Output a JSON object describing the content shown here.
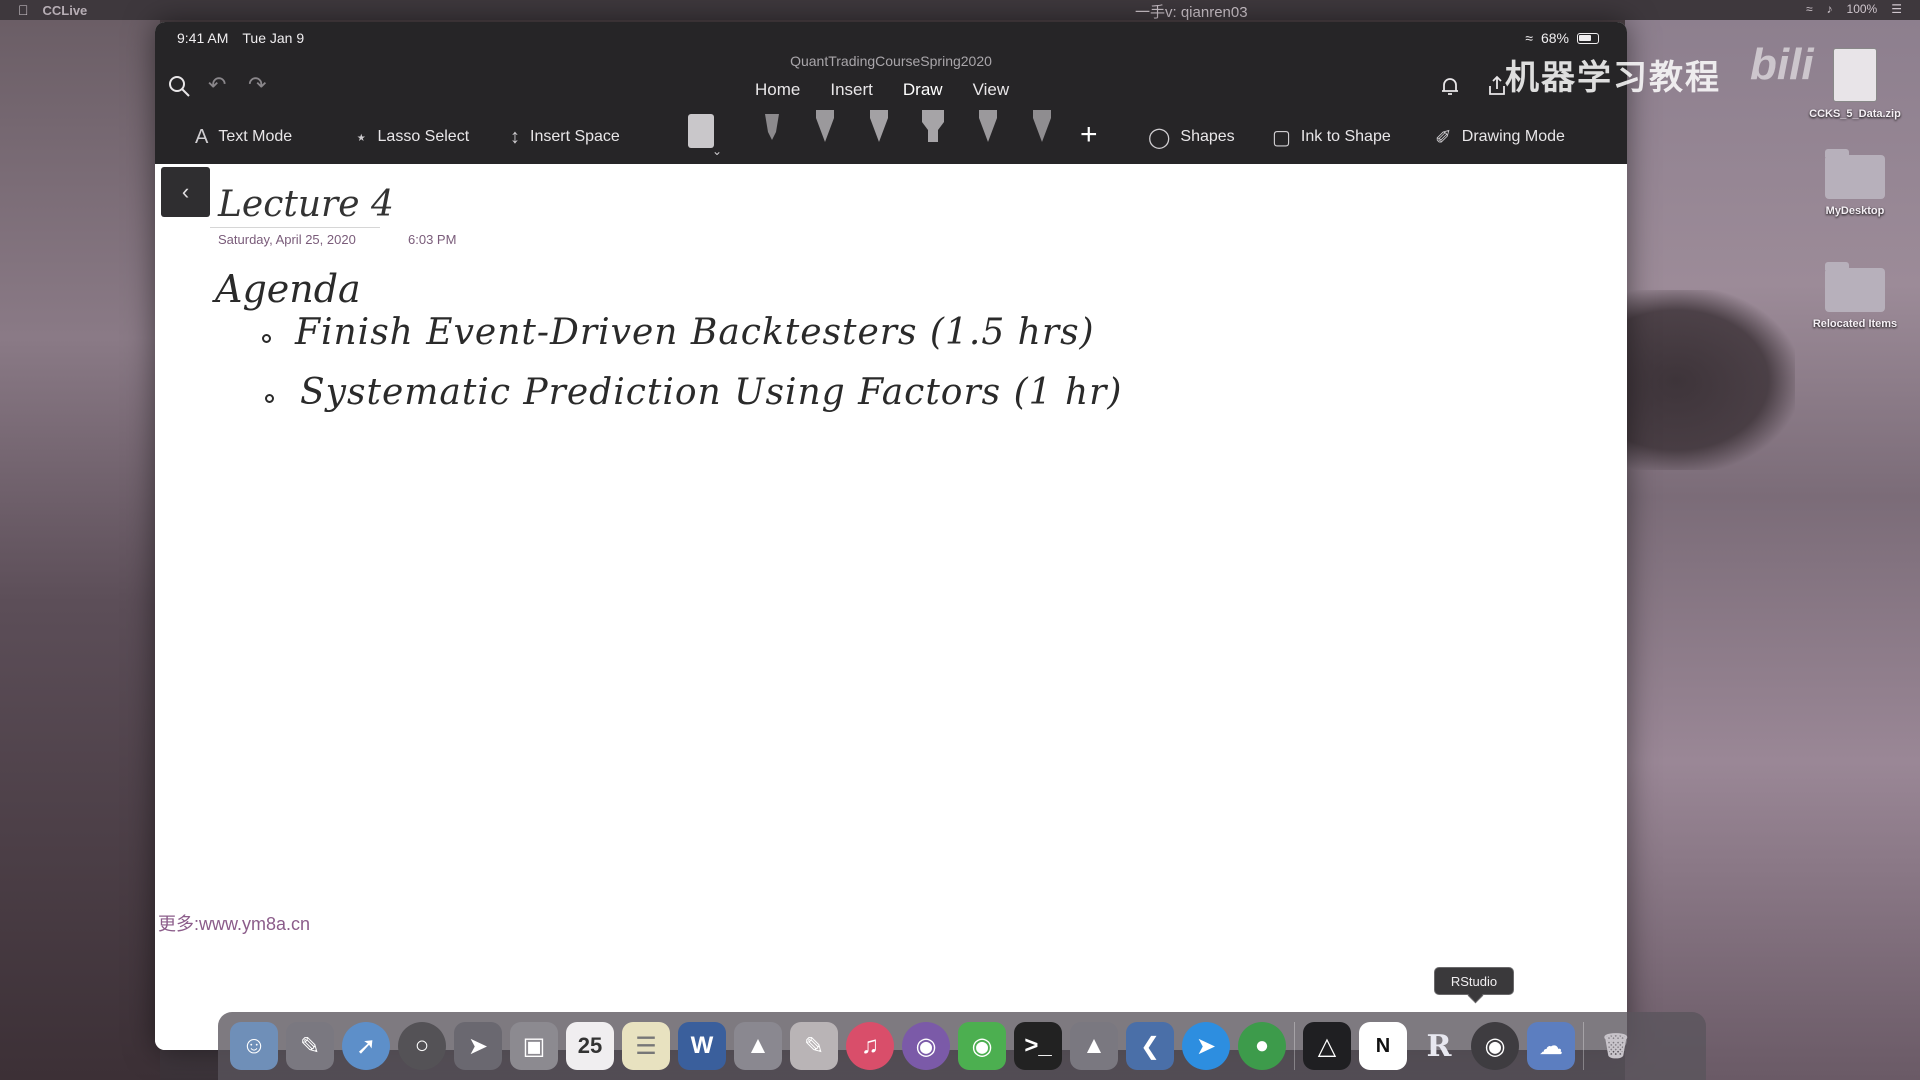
{
  "menubar": {
    "app_name": "CCLive",
    "center_text": "一手v: qianren03",
    "battery": "100%"
  },
  "ipad": {
    "status": {
      "time": "9:41 AM",
      "date": "Tue Jan 9",
      "battery_pct": "68%"
    },
    "notebook_title": "QuantTradingCourseSpring2020",
    "tabs": [
      {
        "label": "Home"
      },
      {
        "label": "Insert"
      },
      {
        "label": "Draw"
      },
      {
        "label": "View"
      }
    ],
    "active_tab": "Draw",
    "tools": {
      "text_mode": "Text Mode",
      "lasso_select": "Lasso Select",
      "insert_space": "Insert Space",
      "shapes": "Shapes",
      "ink_to_shape": "Ink to Shape",
      "drawing_mode": "Drawing Mode"
    },
    "icons": {
      "search": "search-icon",
      "undo": "undo-icon",
      "redo": "redo-icon",
      "bell": "bell-icon",
      "share": "share-icon",
      "back": "chevron-left-icon",
      "add_tool": "plus-icon"
    }
  },
  "page": {
    "title": "Lecture 4",
    "date": "Saturday, April 25, 2020",
    "time": "6:03 PM",
    "agenda_heading": "Agenda",
    "items": [
      "Finish Event-Driven Backtesters (1.5 hrs)",
      "Systematic Prediction Using Factors (1 hr)"
    ]
  },
  "watermark": "更多:www.ym8a.cn",
  "overlay_text": "机器学习教程",
  "desktop_items": [
    {
      "label": "CCKS_5_Data.zip"
    },
    {
      "label": "MyDesktop"
    },
    {
      "label": "Relocated Items"
    }
  ],
  "tooltip": "RStudio",
  "dock": {
    "calendar_day": "25",
    "word_letter": "W",
    "notion_letter": "N",
    "rstudio_letter": "R"
  }
}
